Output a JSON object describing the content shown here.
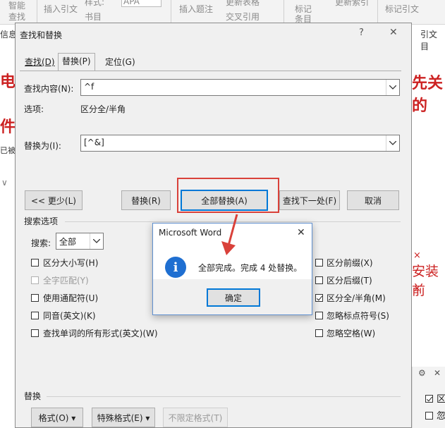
{
  "background": {
    "ribbon": {
      "group1": [
        "智能",
        "查找"
      ],
      "insert_citation": "插入引文",
      "style_label": "样式:",
      "style_value": "APA",
      "bibliography": "书目",
      "insert_caption": "插入题注",
      "update_table": "更新表格",
      "cross_reference": "交叉引用",
      "mark_entry": [
        "标记",
        "条目"
      ],
      "update_index": "更新索引",
      "mark_citation": "标记引文"
    },
    "left_fragments": [
      "信息",
      "电",
      "件",
      "已被"
    ],
    "right_fragments": [
      "引文目",
      "先关的",
      "安装前",
      "区",
      "忽"
    ],
    "right_small": [
      "×",
      "×"
    ]
  },
  "dialog": {
    "title": "查找和替换",
    "help": "?",
    "close": "✕",
    "tabs": [
      "查找(D)",
      "替换(P)",
      "定位(G)"
    ],
    "active_tab": 1,
    "find_label": "查找内容(N):",
    "find_value": "^f",
    "options_label": "选项:",
    "options_value": "区分全/半角",
    "replace_label": "替换为(I):",
    "replace_value": "[^&]",
    "buttons": {
      "less": "<< 更少(L)",
      "replace": "替换(R)",
      "replace_all": "全部替换(A)",
      "find_next": "查找下一处(F)",
      "cancel": "取消"
    },
    "search_options_title": "搜索选项",
    "search_label": "搜索:",
    "search_value": "全部",
    "left_options": [
      {
        "label": "区分大小写(H)",
        "checked": false,
        "disabled": false
      },
      {
        "label": "全字匹配(Y)",
        "checked": false,
        "disabled": true
      },
      {
        "label": "使用通配符(U)",
        "checked": false,
        "disabled": false
      },
      {
        "label": "同音(英文)(K)",
        "checked": false,
        "disabled": false
      },
      {
        "label": "查找单词的所有形式(英文)(W)",
        "checked": false,
        "disabled": false
      }
    ],
    "right_options": [
      {
        "label": "区分前缀(X)",
        "checked": false
      },
      {
        "label": "区分后缀(T)",
        "checked": false
      },
      {
        "label": "区分全/半角(M)",
        "checked": true
      },
      {
        "label": "忽略标点符号(S)",
        "checked": false
      },
      {
        "label": "忽略空格(W)",
        "checked": false
      }
    ],
    "replace_section_title": "替换",
    "bottom_buttons": {
      "format": "格式(O) ▾",
      "special": "特殊格式(E) ▾",
      "no_format": "不限定格式(T)"
    }
  },
  "message_box": {
    "title": "Microsoft Word",
    "close": "✕",
    "text": "全部完成。完成 4 处替换。",
    "ok": "确定"
  },
  "colors": {
    "highlight": "#d9413a",
    "focus": "#0078d7",
    "info_icon": "#1f6fd1",
    "red_text": "#cc2222"
  }
}
